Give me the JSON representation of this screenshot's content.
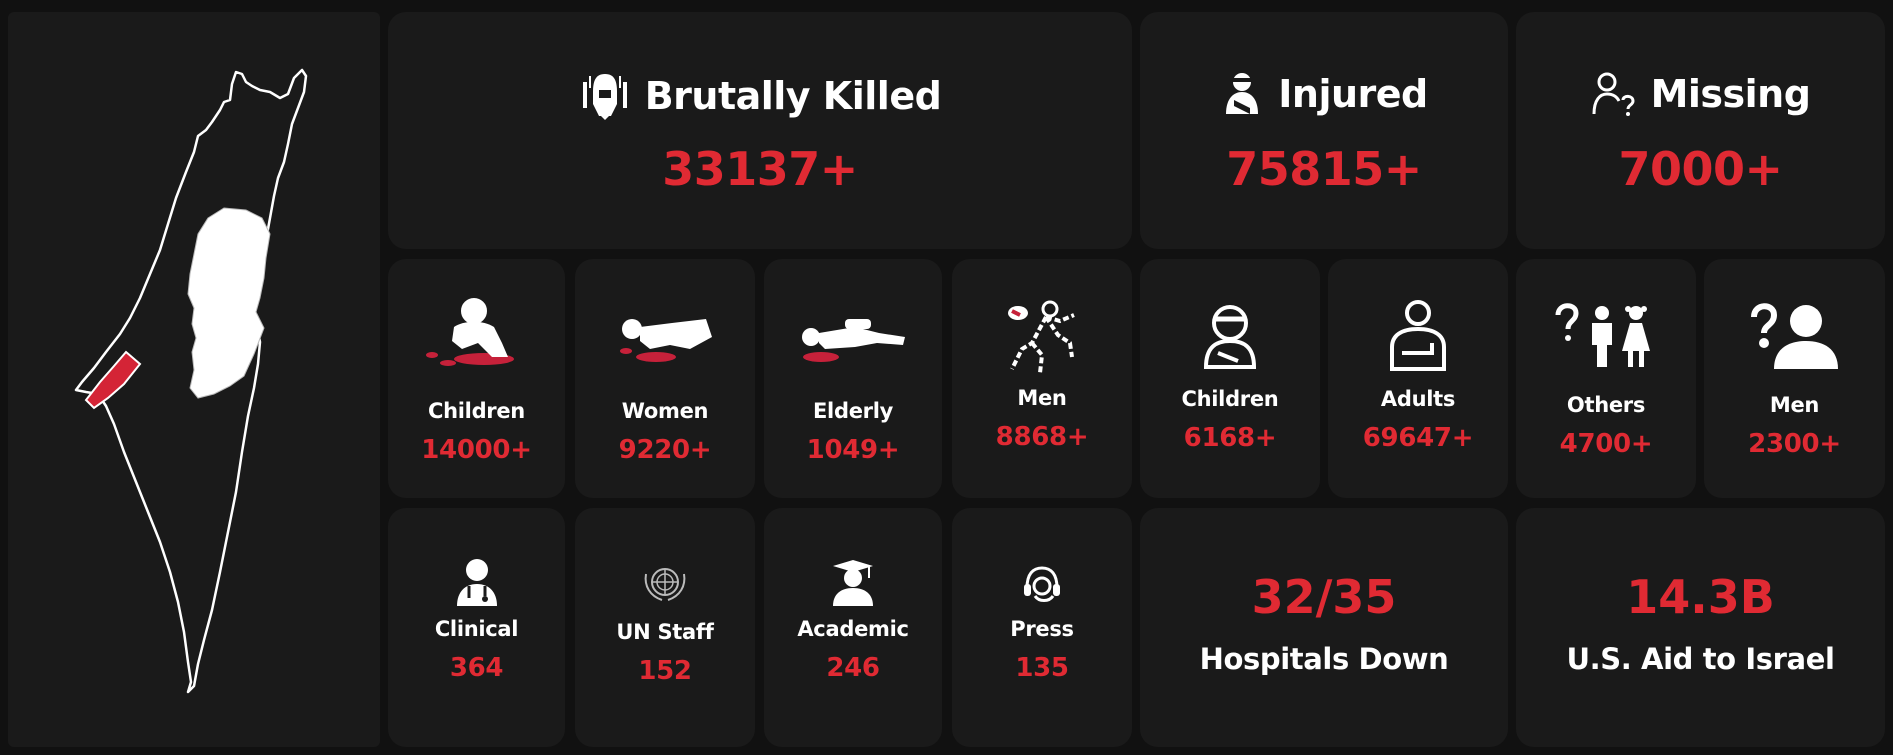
{
  "summary": {
    "killed": {
      "title": "Brutally Killed",
      "value": "33137+",
      "icon": "bomb-icon"
    },
    "injured": {
      "title": "Injured",
      "value": "75815+",
      "icon": "injured-person-icon"
    },
    "missing": {
      "title": "Missing",
      "value": "7000+",
      "icon": "person-question-icon"
    }
  },
  "killed_breakdown": [
    {
      "label": "Children",
      "value": "14000+",
      "icon": "child-casualty-icon"
    },
    {
      "label": "Women",
      "value": "9220+",
      "icon": "woman-casualty-icon"
    },
    {
      "label": "Elderly",
      "value": "1049+",
      "icon": "elderly-casualty-icon"
    },
    {
      "label": "Men",
      "value": "8868+",
      "icon": "chalk-outline-icon"
    }
  ],
  "injured_breakdown": [
    {
      "label": "Children",
      "value": "6168+",
      "icon": "bandaged-child-icon"
    },
    {
      "label": "Adults",
      "value": "69647+",
      "icon": "arm-sling-icon"
    }
  ],
  "missing_breakdown": [
    {
      "label": "Others",
      "value": "4700+",
      "icon": "missing-family-icon"
    },
    {
      "label": "Men",
      "value": "2300+",
      "icon": "missing-man-icon"
    }
  ],
  "professions": [
    {
      "label": "Clinical",
      "value": "364",
      "icon": "doctor-icon"
    },
    {
      "label": "UN Staff",
      "value": "152",
      "icon": "un-emblem-icon"
    },
    {
      "label": "Academic",
      "value": "246",
      "icon": "graduate-icon"
    },
    {
      "label": "Press",
      "value": "135",
      "icon": "headset-icon"
    }
  ],
  "stats": {
    "hospitals": {
      "value": "32/35",
      "label": "Hospitals Down"
    },
    "aid": {
      "value": "14.3B",
      "label": "U.S. Aid to Israel"
    }
  },
  "colors": {
    "accent": "#e02a33",
    "background": "#111111",
    "card": "#1a1a1a",
    "text": "#ffffff"
  }
}
